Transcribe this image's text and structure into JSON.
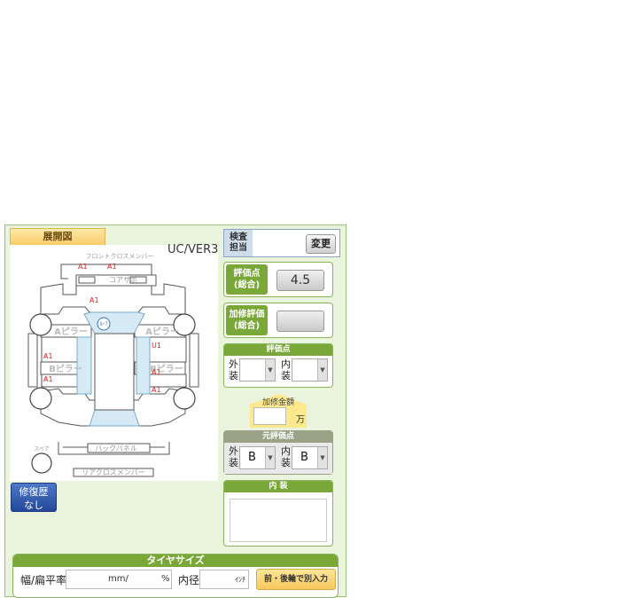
{
  "tab_label": "展開図",
  "model_version": "UC/VER3",
  "inspector": {
    "label_line1": "検査",
    "label_line2": "担当",
    "change_button": "変更"
  },
  "score_total": {
    "label_line1": "評価点",
    "label_line2": "(総合)",
    "value": "4.5"
  },
  "repair_score_total": {
    "label_line1": "加修評価",
    "label_line2": "(総合)",
    "value": ""
  },
  "grade": {
    "title": "評価点",
    "exterior_label_1": "外",
    "exterior_label_2": "装",
    "exterior_value": "",
    "interior_label_1": "内",
    "interior_label_2": "装",
    "interior_value": ""
  },
  "repair_cost": {
    "label": "加修金額",
    "unit": "万",
    "value": ""
  },
  "original_grade": {
    "title": "元評価点",
    "exterior_label_1": "外",
    "exterior_label_2": "装",
    "exterior_value": "B",
    "interior_label_1": "内",
    "interior_label_2": "装",
    "interior_value": "B"
  },
  "interior": {
    "title": "内 装",
    "value": ""
  },
  "repair_history": {
    "line1": "修復歴",
    "line2": "なし"
  },
  "tire": {
    "title": "タイヤサイズ",
    "width_label": "幅/扁平率",
    "width_unit": "mm/",
    "ratio_unit": "%",
    "inner_label": "内径",
    "inner_unit": "ｲﾝﾁ",
    "separate_button": "前・後輪で別入力"
  },
  "diagram": {
    "front_cross": "フロントクロスメンバー",
    "core_support": "コアサポ",
    "a_pillar_left": "Aピラー",
    "a_pillar_right": "Aピラー",
    "b_pillar_left": "Bピラー",
    "b_pillar_right": "Bピラー",
    "back_panel": "バックパネル",
    "rear_cross": "リアクロスメンバー",
    "spare": "スペア",
    "marks": [
      "A1",
      "A1",
      "A1",
      "A1",
      "U1",
      "A1",
      "A1",
      "A1"
    ],
    "roof_mark": "ﾙｰﾌ"
  },
  "colors": {
    "panel_bg": "#eaf3dc",
    "accent_green": "#7aa838",
    "tab_yellow": "#f8cd6a",
    "mark_red": "#e02020",
    "repair_blue": "#24479a"
  }
}
